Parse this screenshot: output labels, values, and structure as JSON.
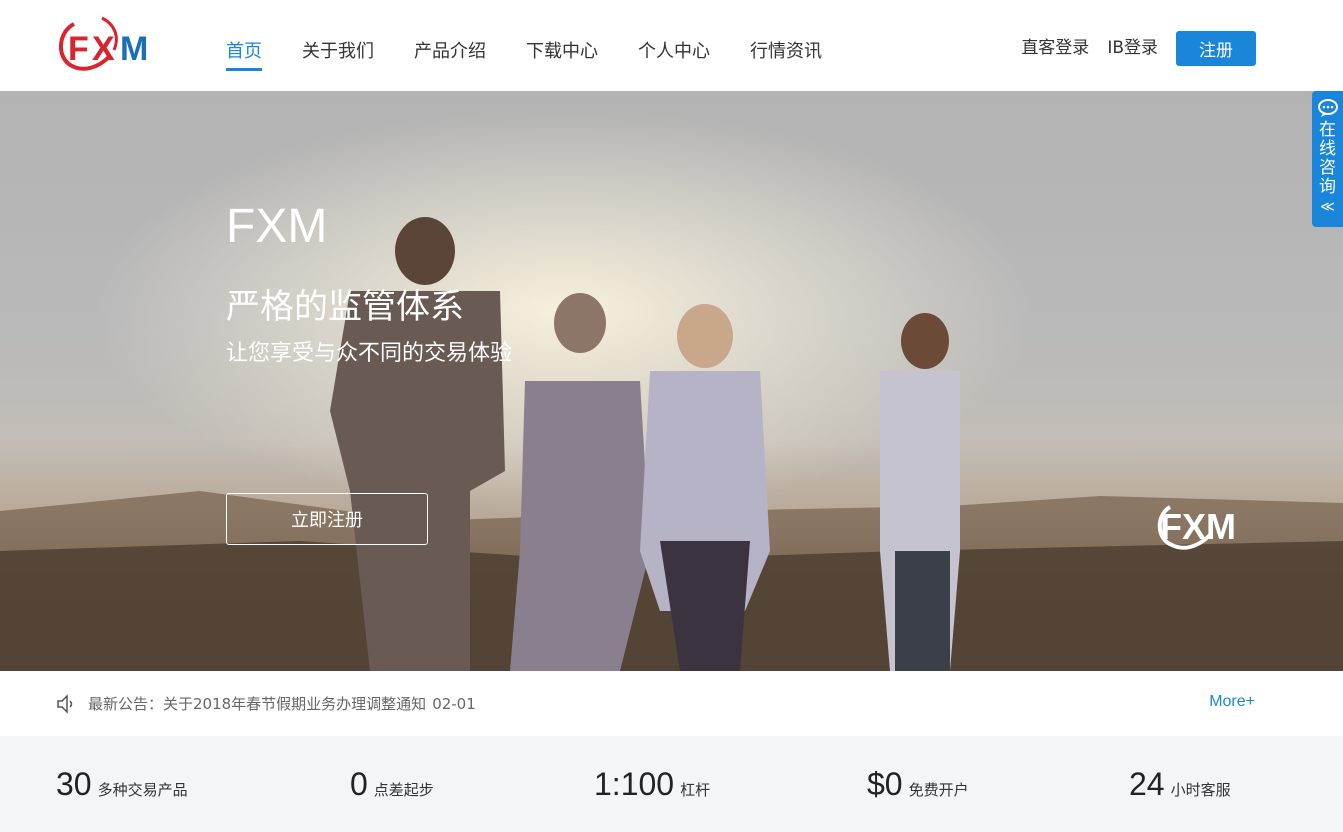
{
  "brand": {
    "logo_text_f": "F",
    "logo_text_x": "X",
    "logo_text_m": "M",
    "logo_red": "#d9232d",
    "logo_blue": "#1a6fb8"
  },
  "nav": {
    "items": [
      "首页",
      "关于我们",
      "产品介绍",
      "下载中心",
      "个人中心",
      "行情资讯"
    ],
    "active_index": 0
  },
  "auth": {
    "direct_login": "直客登录",
    "ib_login": "IB登录",
    "register": "注册"
  },
  "hero": {
    "title": "FXM",
    "subtitle": "严格的监管体系",
    "tagline": "让您享受与众不同的交易体验",
    "cta": "立即注册",
    "watermark": "FXM"
  },
  "consult": {
    "label": "在线咨询",
    "arrows": "≪",
    "icon": "chat-bubble-icon"
  },
  "notice": {
    "icon": "speaker-icon",
    "text": "最新公告：关于2018年春节假期业务办理调整通知",
    "date": "02-01",
    "more": "More+"
  },
  "stats": [
    {
      "num": "30",
      "desc": "多种交易产品"
    },
    {
      "num": "0",
      "desc": "点差起步"
    },
    {
      "num": "1:100",
      "desc": "杠杆"
    },
    {
      "num": "$0",
      "desc": "免费开户"
    },
    {
      "num": "24",
      "desc": "小时客服"
    }
  ],
  "colors": {
    "accent": "#1a86d9",
    "stats_bg": "#f4f5f7"
  }
}
